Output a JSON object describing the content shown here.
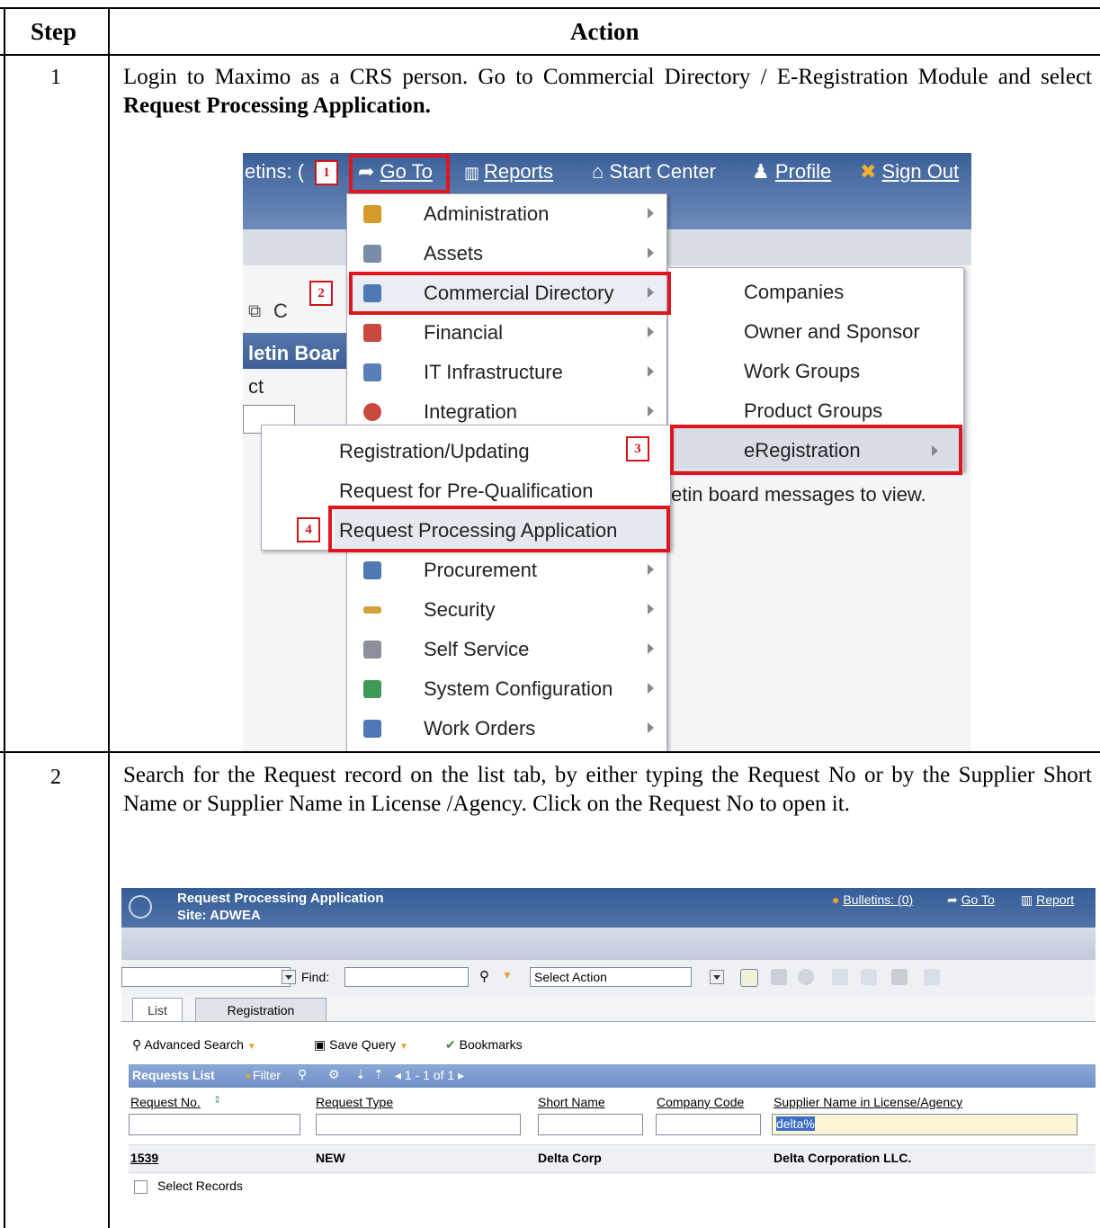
{
  "table": {
    "col_step": "Step",
    "col_action": "Action",
    "rows": [
      {
        "step": "1",
        "text_a": "Login to Maximo as a CRS person. Go to Commercial Directory / E-Registration Module and select ",
        "text_bold": "Request Processing Application."
      },
      {
        "step": "2",
        "text": "Search for the Request record on the list tab, by either typing the Request No or by the Supplier Short Name or Supplier Name in License /Agency. Click on the Request No to open it."
      }
    ]
  },
  "shot1": {
    "topbar": {
      "bulletins": "etins: (",
      "goto": "Go To",
      "reports": "Reports",
      "start_center": "Start Center",
      "profile": "Profile",
      "sign_out": "Sign Out"
    },
    "left_fragments": {
      "fragment_icon_text": "C",
      "bulletin_board": "letin Boar",
      "select": "ct",
      "messages": "etin board messages to view."
    },
    "main_menu": [
      {
        "label": "Administration",
        "color": "#d49a2a"
      },
      {
        "label": "Assets",
        "color": "#7a8ca6"
      },
      {
        "label": "Commercial Directory",
        "color": "#4f79b5"
      },
      {
        "label": "Financial",
        "color": "#c9483f"
      },
      {
        "label": "IT Infrastructure",
        "color": "#5a7fb8"
      },
      {
        "label": "Integration",
        "color": "#c9483f"
      },
      {
        "label": "Procurement",
        "color": "#4f79b5"
      },
      {
        "label": "Security",
        "color": "#d4a13a"
      },
      {
        "label": "Self Service",
        "color": "#8a8f99"
      },
      {
        "label": "System Configuration",
        "color": "#3f9a5a"
      },
      {
        "label": "Work Orders",
        "color": "#4f79b5"
      }
    ],
    "commercial_submenu": [
      "Companies",
      "Owner and Sponsor",
      "Work Groups",
      "Product Groups",
      "eRegistration"
    ],
    "eregistration_submenu": [
      "Registration/Updating",
      "Request for Pre-Qualification",
      "Request Processing Application"
    ],
    "badges": [
      "1",
      "2",
      "3",
      "4"
    ]
  },
  "shot2": {
    "app_title": "Request Processing Application",
    "site": "Site: ADWEA",
    "bulletins": "Bulletins: (0)",
    "goto": "Go To",
    "reports": "Report",
    "find_label": "Find:",
    "select_action": "Select Action",
    "tabs": [
      "List",
      "Registration"
    ],
    "advanced_search": "Advanced Search",
    "save_query": "Save Query",
    "bookmarks": "Bookmarks",
    "list_title": "Requests List",
    "filter": "Filter",
    "paging": "1 - 1 of 1",
    "columns": [
      "Request No.",
      "Request Type",
      "Short Name",
      "Company Code",
      "Supplier Name in License/Agency"
    ],
    "filter_value": "delta%",
    "row": {
      "request_no": "1539",
      "request_type": "NEW",
      "short_name": "Delta Corp",
      "company_code": "",
      "supplier_name": "Delta Corporation LLC."
    },
    "select_records": "Select Records"
  }
}
